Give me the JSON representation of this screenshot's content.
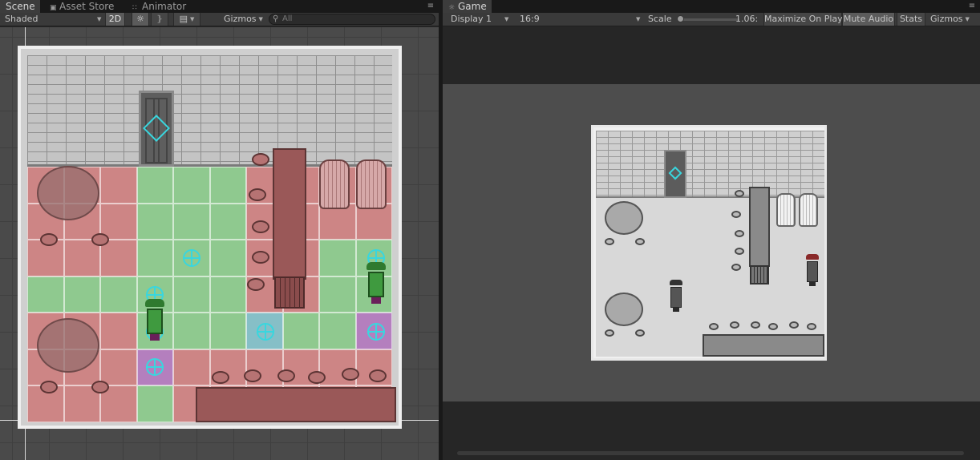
{
  "scene_panel": {
    "tabs": [
      {
        "label": "Scene",
        "icon": "scene-icon"
      },
      {
        "label": "Asset Store",
        "icon": "lock-icon"
      },
      {
        "label": "Animator",
        "icon": "animator-icon"
      }
    ],
    "toolbar": {
      "shading_mode": "Shaded",
      "mode_2d_label": "2D",
      "gizmos_label": "Gizmos",
      "search_placeholder": "All"
    }
  },
  "game_panel": {
    "tab_label": "Game",
    "toolbar": {
      "display": "Display 1",
      "aspect": "16:9",
      "scale_label": "Scale",
      "scale_value": "1.06:",
      "maximize_label": "Maximize On Play",
      "mute_label": "Mute Audio",
      "stats_label": "Stats",
      "gizmos_label": "Gizmos"
    }
  },
  "colors": {
    "walkable_cell": "#8fc98f",
    "blocked_cell": "#cd8585",
    "path_cell": "#86bfc7",
    "agent_cell": "#b47fbe",
    "gizmo": "#39d6de"
  }
}
